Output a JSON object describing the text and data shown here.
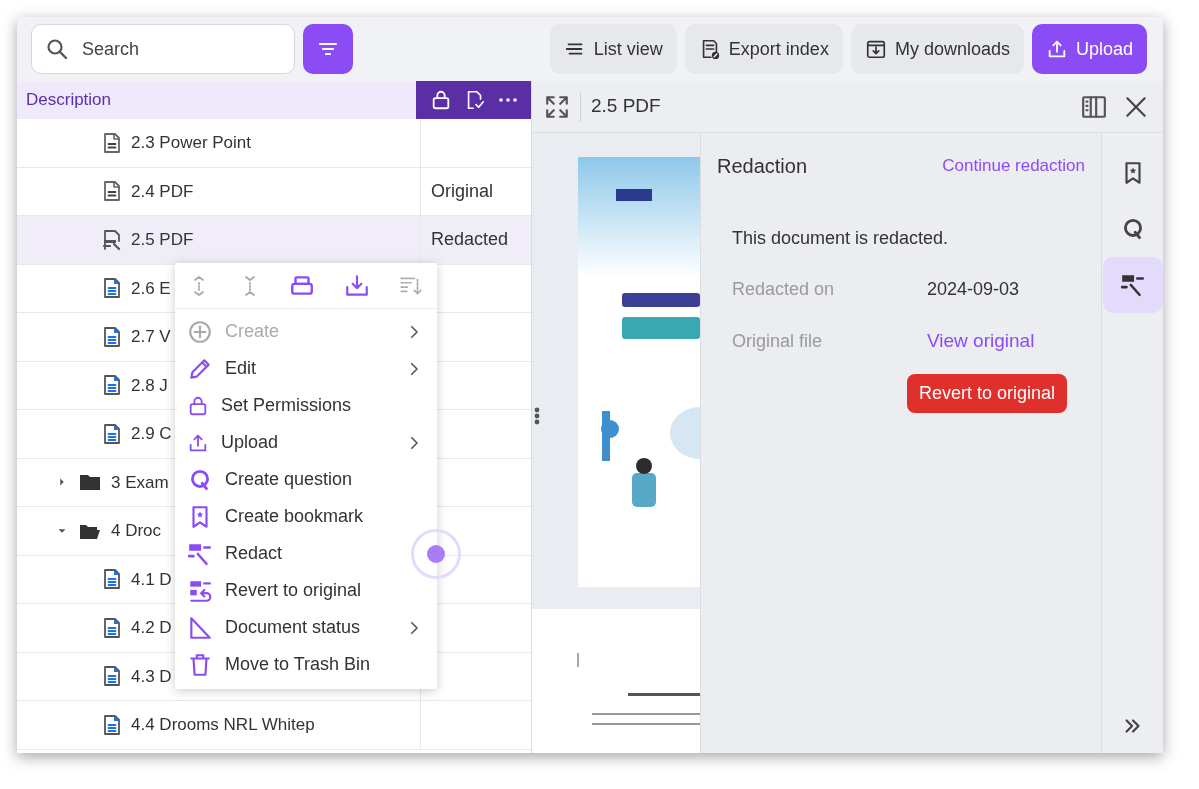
{
  "toolbar": {
    "search": {
      "placeholder": "Search"
    },
    "buttons": [
      {
        "label": "List view",
        "kind": "list",
        "primary": false
      },
      {
        "label": "Export index",
        "kind": "export",
        "primary": false
      },
      {
        "label": "My downloads",
        "kind": "downloads",
        "primary": false
      },
      {
        "label": "Upload",
        "kind": "upload",
        "primary": true
      }
    ]
  },
  "table": {
    "columns": [
      "Description"
    ],
    "rows": [
      {
        "label": "2.3 Power Point",
        "kind": "gray-file",
        "selected": false
      },
      {
        "label": "2.4 PDF",
        "kind": "gray-file",
        "selected": false,
        "column_2": "Original"
      },
      {
        "label": "2.5 PDF",
        "kind": "redacted-file",
        "selected": true,
        "column_2": "Redacted"
      },
      {
        "label": "2.6 E",
        "kind": "blue-file",
        "selected": false
      },
      {
        "label": "2.7 V",
        "kind": "blue-file",
        "selected": false
      },
      {
        "label": "2.8 J",
        "kind": "blue-file",
        "selected": false
      },
      {
        "label": "2.9 C",
        "kind": "blue-file",
        "selected": false
      },
      {
        "label": "3 Exam",
        "kind": "folder",
        "selected": false,
        "expanded": false
      },
      {
        "label": "4 Droc",
        "kind": "folder",
        "selected": false,
        "expanded": true,
        "children": [
          {
            "label": "4.1 D",
            "kind": "blue-file",
            "selected": false
          },
          {
            "label": "4.2 D",
            "kind": "blue-file",
            "selected": false
          },
          {
            "label": "4.3 D",
            "kind": "blue-file",
            "selected": false
          },
          {
            "label": "4.4 Drooms NRL Whitep",
            "kind": "blue-file",
            "selected": false
          }
        ]
      }
    ]
  },
  "context_menu": {
    "tools": [
      {
        "kind": "expand",
        "disabled": true
      },
      {
        "kind": "collapse",
        "disabled": true
      },
      {
        "kind": "print",
        "disabled": false
      },
      {
        "kind": "download",
        "disabled": false
      },
      {
        "kind": "sort",
        "disabled": true
      }
    ],
    "items": [
      {
        "label": "Create",
        "kind": "create",
        "disabled": true,
        "submenu": true
      },
      {
        "label": "Edit",
        "kind": "edit",
        "disabled": false,
        "submenu": true
      },
      {
        "label": "Set Permissions",
        "kind": "lock",
        "disabled": false,
        "submenu": false
      },
      {
        "label": "Upload",
        "kind": "upload",
        "disabled": false,
        "submenu": true
      },
      {
        "label": "Create question",
        "kind": "question",
        "disabled": false,
        "submenu": false
      },
      {
        "label": "Create bookmark",
        "kind": "bookmark",
        "disabled": false,
        "submenu": false
      },
      {
        "label": "Redact",
        "kind": "redact",
        "disabled": false,
        "submenu": false,
        "pointer": true
      },
      {
        "label": "Revert to original",
        "kind": "revert",
        "disabled": false,
        "submenu": false
      },
      {
        "label": "Document status",
        "kind": "status",
        "disabled": false,
        "submenu": true
      },
      {
        "label": "Move to Trash Bin",
        "kind": "trash",
        "disabled": false,
        "submenu": false
      }
    ]
  },
  "viewer": {
    "title": "2.5 PDF",
    "redaction": {
      "title": "Redaction",
      "action": "Continue redaction",
      "message": "This document is redacted.",
      "fields": [
        {
          "label": "Redacted on",
          "value": "2024-09-03",
          "kind": "text"
        },
        {
          "label": "Original file",
          "value": "View original",
          "kind": "link"
        }
      ],
      "button": "Revert to original"
    },
    "rail": [
      {
        "kind": "bookmark",
        "selected": false
      },
      {
        "kind": "question",
        "selected": false
      },
      {
        "kind": "redact",
        "selected": true
      }
    ]
  }
}
